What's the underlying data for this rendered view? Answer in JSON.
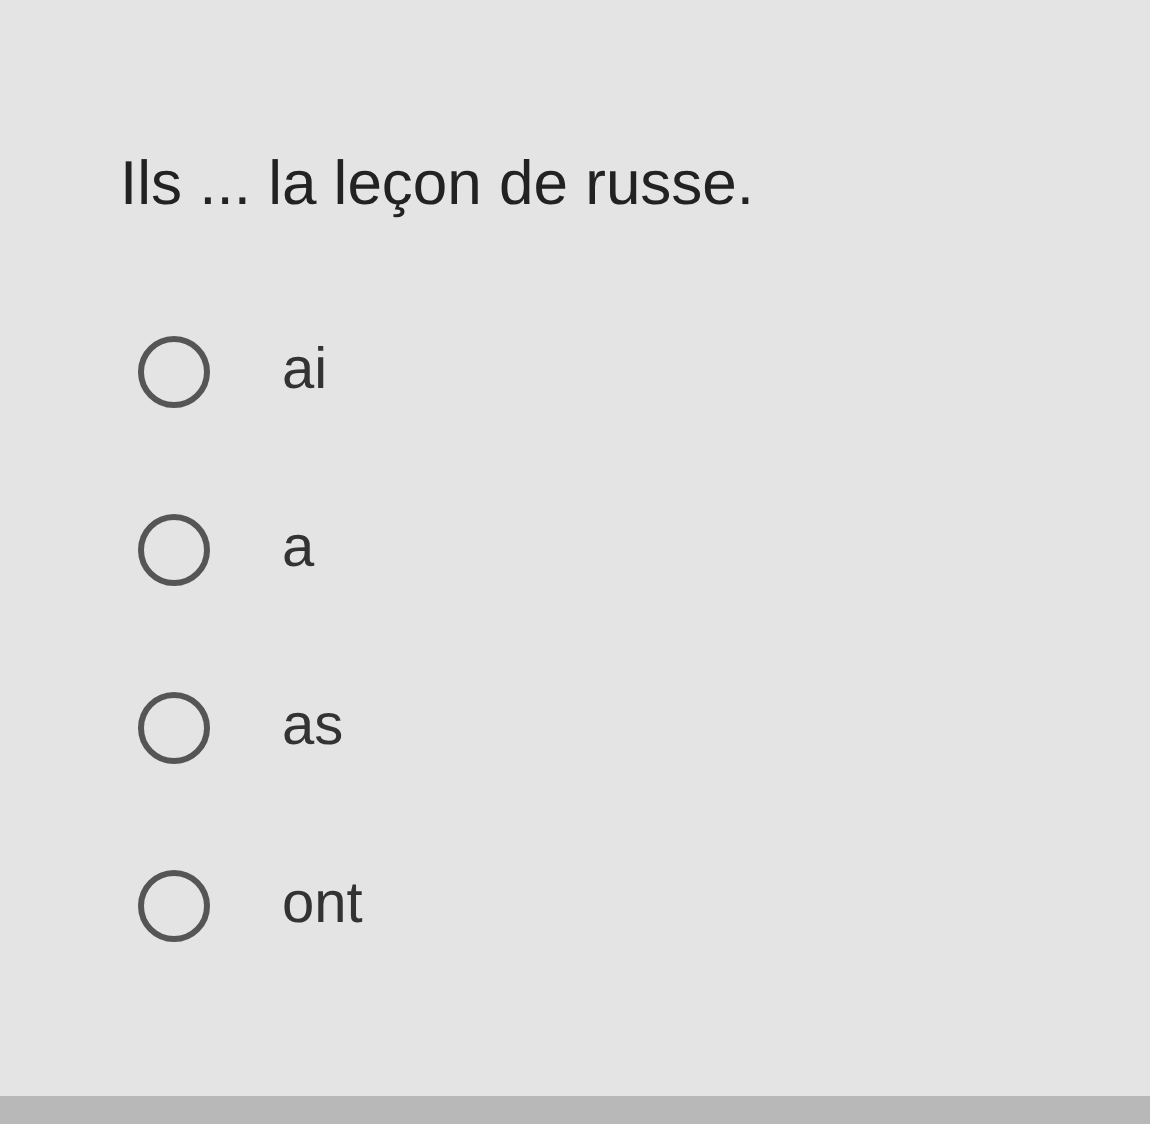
{
  "question": "Ils ... la leçon de russe.",
  "options": [
    {
      "label": "ai",
      "selected": false
    },
    {
      "label": "a",
      "selected": false
    },
    {
      "label": "as",
      "selected": false
    },
    {
      "label": "ont",
      "selected": false
    }
  ]
}
